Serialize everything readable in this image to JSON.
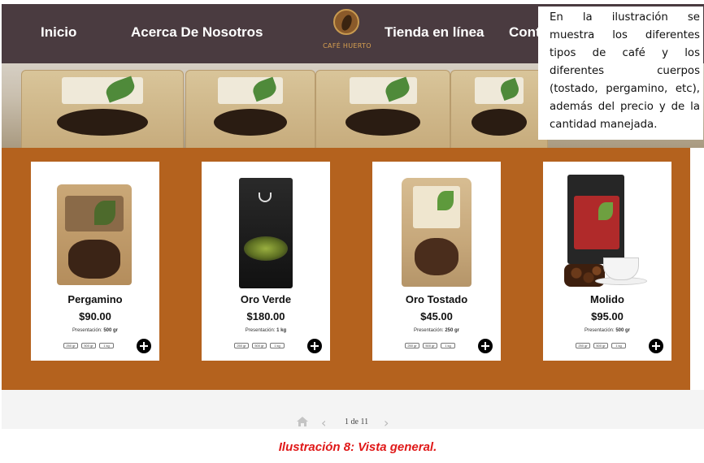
{
  "nav": {
    "items": [
      "Inicio",
      "Acerca De Nosotros",
      "Tienda en línea",
      "Cont"
    ],
    "logo_text": "CAFÉ HUERTO",
    "background": "#4a3b40"
  },
  "products": [
    {
      "name": "Pergamino",
      "price": "$90.00",
      "presentation_label": "Presentación:",
      "presentation_value": "500 gr",
      "sizes": [
        "250 gr",
        "500 gr",
        "1 kg"
      ]
    },
    {
      "name": "Oro Verde",
      "price": "$180.00",
      "presentation_label": "Presentación:",
      "presentation_value": "1 kg",
      "sizes": [
        "250 gr",
        "500 gr",
        "1 kg"
      ]
    },
    {
      "name": "Oro Tostado",
      "price": "$45.00",
      "presentation_label": "Presentación:",
      "presentation_value": "250 gr",
      "sizes": [
        "250 gr",
        "500 gr",
        "1 kg"
      ]
    },
    {
      "name": "Molido",
      "price": "$95.00",
      "presentation_label": "Presentación:",
      "presentation_value": "500 gr",
      "sizes": [
        "250 gr",
        "500 gr",
        "1 kg"
      ]
    }
  ],
  "colors": {
    "products_background": "#b4621e",
    "caption": "#e01818"
  },
  "pagination": {
    "text": "1 de 11",
    "prev": "‹",
    "next": "›"
  },
  "note": {
    "text": "En la ilustración se muestra los diferentes tipos de café y los diferentes cuerpos (tostado, pergamino, etc), además del precio y de la cantidad manejada."
  },
  "caption": "Ilustración 8: Vista general."
}
